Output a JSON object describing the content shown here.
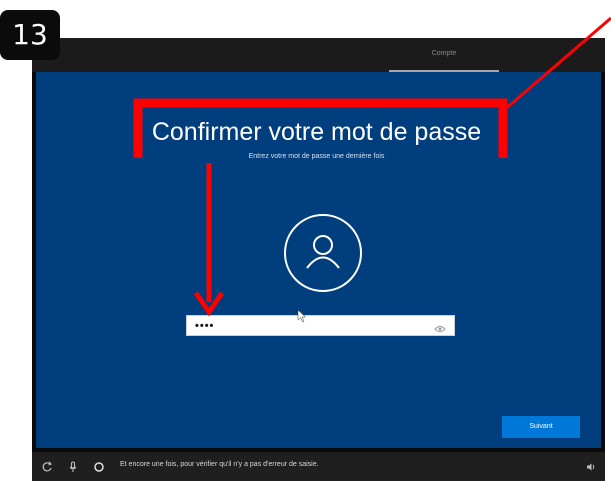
{
  "step": {
    "number": "13"
  },
  "header": {
    "tab_label": "Compte"
  },
  "main": {
    "title": "Confirmer votre mot de passe",
    "subtitle": "Entrez votre mot de passe une dernière fois",
    "password": {
      "value": "••••",
      "reveal_icon": "eye-icon"
    },
    "next_label": "Suivant"
  },
  "bottom_bar": {
    "icons": [
      "ease-of-access-icon",
      "microphone-icon",
      "cortana-icon",
      "volume-icon"
    ],
    "message": "Et encore une fois, pour vérifier qu'il n'y a pas d'erreur de saisie."
  },
  "colors": {
    "oobe_blue": "#003e7e",
    "button_blue": "#0078d7",
    "annotation_red": "#ff0000"
  }
}
